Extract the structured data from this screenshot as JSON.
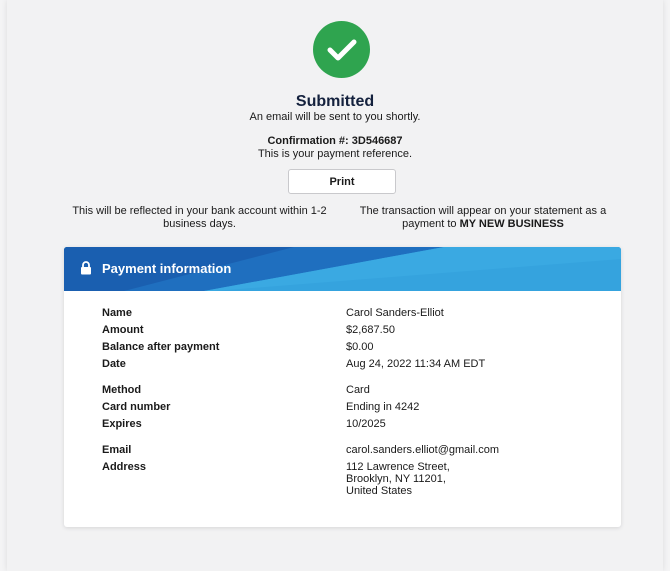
{
  "status": {
    "title": "Submitted",
    "subtitle": "An email will be sent to you shortly.",
    "confirmation": "Confirmation #: 3D546687",
    "reference_note": "This is your payment reference.",
    "icon": "checkmark-icon",
    "icon_color": "#2fa44f"
  },
  "print_button": {
    "label": "Print"
  },
  "notes": {
    "bank": "This will be reflected in your bank account within 1-2 business days.",
    "statement_prefix": "The transaction will appear on your statement as a payment to ",
    "statement_business": "MY NEW BUSINESS"
  },
  "payment_info": {
    "title": "Payment information",
    "icon": "lock-icon",
    "header_color": "#2f98d8",
    "rows": [
      {
        "label": "Name",
        "value": "Carol Sanders-Elliot"
      },
      {
        "label": "Amount",
        "value": "$2,687.50"
      },
      {
        "label": "Balance after payment",
        "value": "$0.00"
      },
      {
        "label": "Date",
        "value": "Aug 24, 2022 11:34 AM EDT"
      },
      {
        "label": "Method",
        "value": "Card"
      },
      {
        "label": "Card number",
        "value": "Ending in 4242"
      },
      {
        "label": "Expires",
        "value": "10/2025"
      },
      {
        "label": "Email",
        "value": "carol.sanders.elliot@gmail.com"
      },
      {
        "label": "Address",
        "value_lines": [
          "112 Lawrence Street,",
          "Brooklyn, NY 11201,",
          "United States"
        ]
      }
    ]
  }
}
